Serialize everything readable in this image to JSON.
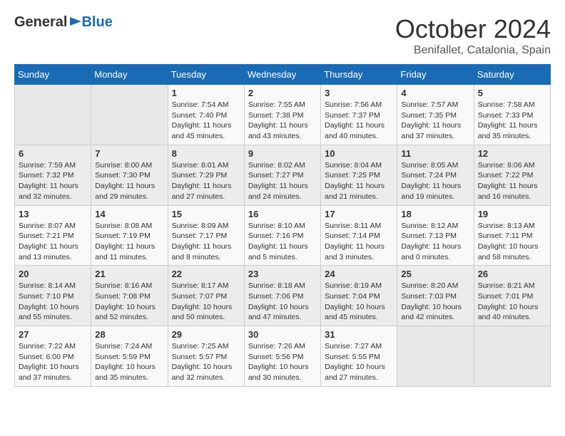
{
  "header": {
    "logo_general": "General",
    "logo_blue": "Blue",
    "month_year": "October 2024",
    "location": "Benifallet, Catalonia, Spain"
  },
  "days_of_week": [
    "Sunday",
    "Monday",
    "Tuesday",
    "Wednesday",
    "Thursday",
    "Friday",
    "Saturday"
  ],
  "weeks": [
    [
      {
        "day": "",
        "info": ""
      },
      {
        "day": "",
        "info": ""
      },
      {
        "day": "1",
        "info": "Sunrise: 7:54 AM\nSunset: 7:40 PM\nDaylight: 11 hours and 45 minutes."
      },
      {
        "day": "2",
        "info": "Sunrise: 7:55 AM\nSunset: 7:38 PM\nDaylight: 11 hours and 43 minutes."
      },
      {
        "day": "3",
        "info": "Sunrise: 7:56 AM\nSunset: 7:37 PM\nDaylight: 11 hours and 40 minutes."
      },
      {
        "day": "4",
        "info": "Sunrise: 7:57 AM\nSunset: 7:35 PM\nDaylight: 11 hours and 37 minutes."
      },
      {
        "day": "5",
        "info": "Sunrise: 7:58 AM\nSunset: 7:33 PM\nDaylight: 11 hours and 35 minutes."
      }
    ],
    [
      {
        "day": "6",
        "info": "Sunrise: 7:59 AM\nSunset: 7:32 PM\nDaylight: 11 hours and 32 minutes."
      },
      {
        "day": "7",
        "info": "Sunrise: 8:00 AM\nSunset: 7:30 PM\nDaylight: 11 hours and 29 minutes."
      },
      {
        "day": "8",
        "info": "Sunrise: 8:01 AM\nSunset: 7:29 PM\nDaylight: 11 hours and 27 minutes."
      },
      {
        "day": "9",
        "info": "Sunrise: 8:02 AM\nSunset: 7:27 PM\nDaylight: 11 hours and 24 minutes."
      },
      {
        "day": "10",
        "info": "Sunrise: 8:04 AM\nSunset: 7:25 PM\nDaylight: 11 hours and 21 minutes."
      },
      {
        "day": "11",
        "info": "Sunrise: 8:05 AM\nSunset: 7:24 PM\nDaylight: 11 hours and 19 minutes."
      },
      {
        "day": "12",
        "info": "Sunrise: 8:06 AM\nSunset: 7:22 PM\nDaylight: 11 hours and 16 minutes."
      }
    ],
    [
      {
        "day": "13",
        "info": "Sunrise: 8:07 AM\nSunset: 7:21 PM\nDaylight: 11 hours and 13 minutes."
      },
      {
        "day": "14",
        "info": "Sunrise: 8:08 AM\nSunset: 7:19 PM\nDaylight: 11 hours and 11 minutes."
      },
      {
        "day": "15",
        "info": "Sunrise: 8:09 AM\nSunset: 7:17 PM\nDaylight: 11 hours and 8 minutes."
      },
      {
        "day": "16",
        "info": "Sunrise: 8:10 AM\nSunset: 7:16 PM\nDaylight: 11 hours and 5 minutes."
      },
      {
        "day": "17",
        "info": "Sunrise: 8:11 AM\nSunset: 7:14 PM\nDaylight: 11 hours and 3 minutes."
      },
      {
        "day": "18",
        "info": "Sunrise: 8:12 AM\nSunset: 7:13 PM\nDaylight: 11 hours and 0 minutes."
      },
      {
        "day": "19",
        "info": "Sunrise: 8:13 AM\nSunset: 7:11 PM\nDaylight: 10 hours and 58 minutes."
      }
    ],
    [
      {
        "day": "20",
        "info": "Sunrise: 8:14 AM\nSunset: 7:10 PM\nDaylight: 10 hours and 55 minutes."
      },
      {
        "day": "21",
        "info": "Sunrise: 8:16 AM\nSunset: 7:08 PM\nDaylight: 10 hours and 52 minutes."
      },
      {
        "day": "22",
        "info": "Sunrise: 8:17 AM\nSunset: 7:07 PM\nDaylight: 10 hours and 50 minutes."
      },
      {
        "day": "23",
        "info": "Sunrise: 8:18 AM\nSunset: 7:06 PM\nDaylight: 10 hours and 47 minutes."
      },
      {
        "day": "24",
        "info": "Sunrise: 8:19 AM\nSunset: 7:04 PM\nDaylight: 10 hours and 45 minutes."
      },
      {
        "day": "25",
        "info": "Sunrise: 8:20 AM\nSunset: 7:03 PM\nDaylight: 10 hours and 42 minutes."
      },
      {
        "day": "26",
        "info": "Sunrise: 8:21 AM\nSunset: 7:01 PM\nDaylight: 10 hours and 40 minutes."
      }
    ],
    [
      {
        "day": "27",
        "info": "Sunrise: 7:22 AM\nSunset: 6:00 PM\nDaylight: 10 hours and 37 minutes."
      },
      {
        "day": "28",
        "info": "Sunrise: 7:24 AM\nSunset: 5:59 PM\nDaylight: 10 hours and 35 minutes."
      },
      {
        "day": "29",
        "info": "Sunrise: 7:25 AM\nSunset: 5:57 PM\nDaylight: 10 hours and 32 minutes."
      },
      {
        "day": "30",
        "info": "Sunrise: 7:26 AM\nSunset: 5:56 PM\nDaylight: 10 hours and 30 minutes."
      },
      {
        "day": "31",
        "info": "Sunrise: 7:27 AM\nSunset: 5:55 PM\nDaylight: 10 hours and 27 minutes."
      },
      {
        "day": "",
        "info": ""
      },
      {
        "day": "",
        "info": ""
      }
    ]
  ]
}
